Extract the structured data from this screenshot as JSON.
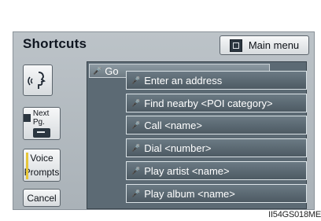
{
  "header": {
    "title": "Shortcuts",
    "main_menu_label": "Main menu"
  },
  "left_panel": {
    "voice_icon": "voice-icon",
    "next_page_label": "Next Pg.",
    "voice_prompts_line1": "Voice",
    "voice_prompts_line2": "Prompts",
    "cancel_label": "Cancel"
  },
  "list": {
    "go_label": "Go",
    "items": [
      {
        "label": "Enter an address"
      },
      {
        "label": "Find nearby <POI category>"
      },
      {
        "label": "Call <name>"
      },
      {
        "label": "Dial <number>"
      },
      {
        "label": "Play artist <name>"
      },
      {
        "label": "Play album <name>"
      }
    ]
  },
  "caption": "II54GS018ME"
}
